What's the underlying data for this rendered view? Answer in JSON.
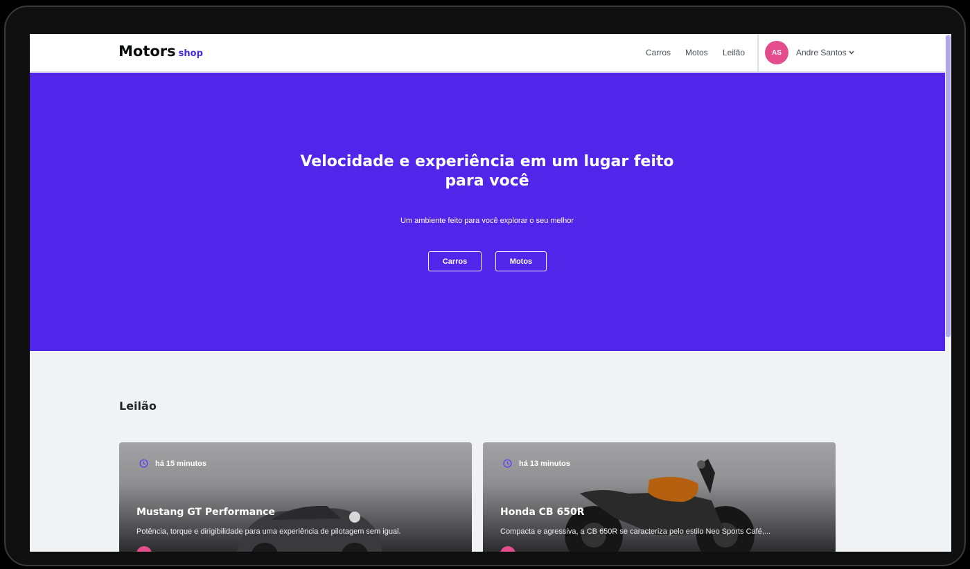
{
  "header": {
    "logo_main": "Motors",
    "logo_sub": "shop",
    "nav": [
      "Carros",
      "Motos",
      "Leilão"
    ],
    "user_initials": "AS",
    "user_name": "Andre Santos"
  },
  "hero": {
    "title": "Velocidade e experiência em um lugar feito para você",
    "subtitle": "Um ambiente feito para você explorar o seu melhor",
    "buttons": [
      "Carros",
      "Motos"
    ]
  },
  "auction": {
    "title": "Leilão",
    "cards": [
      {
        "time": "há 15 minutos",
        "title": "Mustang GT Performance",
        "description": "Potência, torque e dirigibilidade para uma experiência de pilotagem sem igual."
      },
      {
        "time": "há 13 minutos",
        "title": "Honda CB 650R",
        "description": "Compacta e agressiva, a CB 650R se caracteriza pelo estilo Neo Sports Café,..."
      }
    ]
  },
  "colors": {
    "brand": "#5126ea",
    "avatar": "#e34d8c",
    "accent_text": "#4529e6"
  }
}
